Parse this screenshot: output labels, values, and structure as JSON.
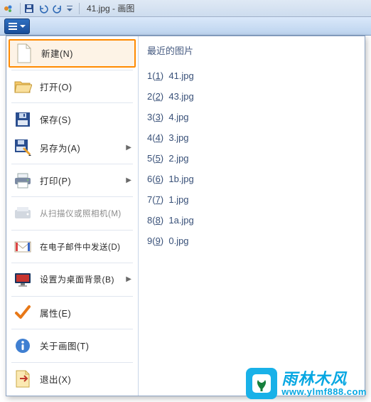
{
  "titlebar": {
    "title": "41.jpg - 画图"
  },
  "menu": {
    "items": [
      {
        "label": "新建(N)",
        "hasArrow": false
      },
      {
        "label": "打开(O)",
        "hasArrow": false
      },
      {
        "label": "保存(S)",
        "hasArrow": false
      },
      {
        "label": "另存为(A)",
        "hasArrow": true
      },
      {
        "label": "打印(P)",
        "hasArrow": true
      },
      {
        "label": "从扫描仪或照相机(M)",
        "hasArrow": false
      },
      {
        "label": "在电子邮件中发送(D)",
        "hasArrow": false
      },
      {
        "label": "设置为桌面背景(B)",
        "hasArrow": true
      },
      {
        "label": "属性(E)",
        "hasArrow": false
      },
      {
        "label": "关于画图(T)",
        "hasArrow": false
      },
      {
        "label": "退出(X)",
        "hasArrow": false
      }
    ]
  },
  "recent": {
    "heading": "最近的图片",
    "items": [
      {
        "num": "1",
        "file": "41.jpg"
      },
      {
        "num": "2",
        "file": "43.jpg"
      },
      {
        "num": "3",
        "file": "4.jpg"
      },
      {
        "num": "4",
        "file": "3.jpg"
      },
      {
        "num": "5",
        "file": "2.jpg"
      },
      {
        "num": "6",
        "file": "1b.jpg"
      },
      {
        "num": "7",
        "file": "1.jpg"
      },
      {
        "num": "8",
        "file": "1a.jpg"
      },
      {
        "num": "9",
        "file": "0.jpg"
      }
    ]
  },
  "watermark": {
    "cn": "雨林木风",
    "url": "www.ylmf888.com"
  }
}
